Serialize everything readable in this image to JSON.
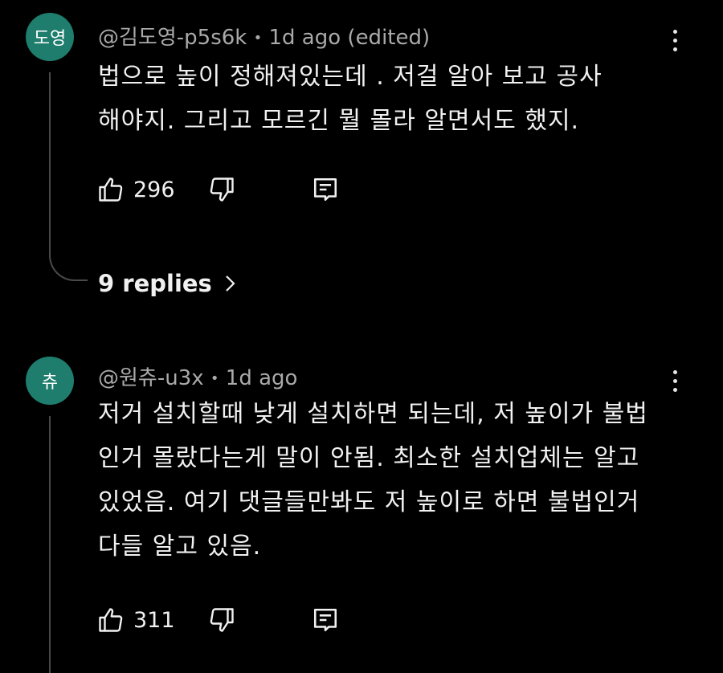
{
  "comments": [
    {
      "avatar_text": "도영",
      "avatar_color": "#1e7d6c",
      "author": "@김도영-p5s6k",
      "separator": "•",
      "time": "1d ago (edited)",
      "lines": [
        "법으로  높이  정해져있는데  . 저걸  알아  보고  공사",
        "해야지.  그리고   모르긴  뭘  몰라   알면서도   했지."
      ],
      "likes": "296",
      "replies_label": "9 replies",
      "menu_icon": "more-vert-icon"
    },
    {
      "avatar_text": "츄",
      "avatar_color": "#1e7d6c",
      "author": "@원츄-u3x",
      "separator": "•",
      "time": "1d ago",
      "lines": [
        "저거 설치할때 낮게 설치하면 되는데, 저  높이가 불법",
        "인거 몰랐다는게 말이 안됨. 최소한 설치업체는 알고",
        "있었음. 여기 댓글들만봐도 저 높이로 하면 불법인거",
        "다들 알고 있음."
      ],
      "likes": "311",
      "menu_icon": "more-vert-icon"
    }
  ],
  "icons": {
    "like": "thumb-up-icon",
    "dislike": "thumb-down-icon",
    "reply": "reply-comment-icon",
    "chevron": "chevron-right-icon"
  },
  "colors": {
    "background": "#000000",
    "text": "#f1f1f1",
    "meta": "#aaaaaa",
    "thread_line": "#4a4a4a"
  }
}
